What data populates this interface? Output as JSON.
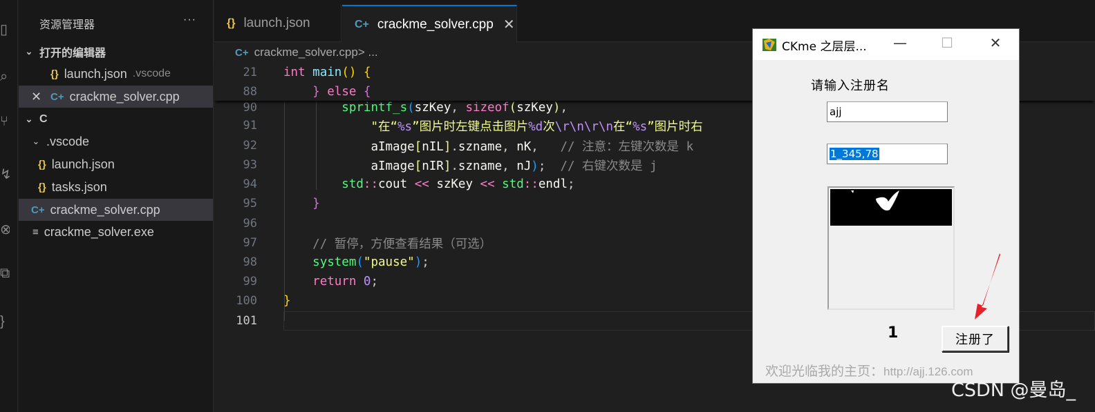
{
  "sidebar": {
    "title": "资源管理器",
    "more": "···",
    "open_editors_header": "打开的编辑器",
    "open_editors": [
      {
        "icon": "{}",
        "name": "launch.json",
        "hint": ".vscode"
      },
      {
        "icon": "C+",
        "name": "crackme_solver.cpp",
        "close": "✕"
      }
    ],
    "folder": "C",
    "subfolder": ".vscode",
    "files": [
      {
        "icon": "{}",
        "name": "launch.json"
      },
      {
        "icon": "{}",
        "name": "tasks.json"
      },
      {
        "icon": "C+",
        "name": "crackme_solver.cpp"
      },
      {
        "icon": "≡",
        "name": "crackme_solver.exe"
      }
    ]
  },
  "tabs": [
    {
      "icon": "{}",
      "label": "launch.json"
    },
    {
      "icon": "C+",
      "label": "crackme_solver.cpp",
      "close": "✕"
    }
  ],
  "breadcrumb": {
    "file": "crackme_solver.cpp",
    "rest": " > ..."
  },
  "editor": {
    "line_numbers": [
      "21",
      "88",
      "90",
      "91",
      "92",
      "93",
      "94",
      "95",
      "96",
      "97",
      "98",
      "99",
      "100",
      "101"
    ]
  },
  "dialog": {
    "title": "CKme 之层层...",
    "minimize": "—",
    "maximize": "☐",
    "close": "✕",
    "label": "请输入注册名",
    "name_value": "ajj",
    "serial_value": "1_345,78",
    "count": "1",
    "button": "注册了",
    "welcome": "欢迎光临我的主页：",
    "url": "http://ajj.126.com"
  },
  "watermark": "CSDN @曼岛_",
  "colors": {
    "accent": "#0078d4",
    "arrow": "#e8202a"
  }
}
